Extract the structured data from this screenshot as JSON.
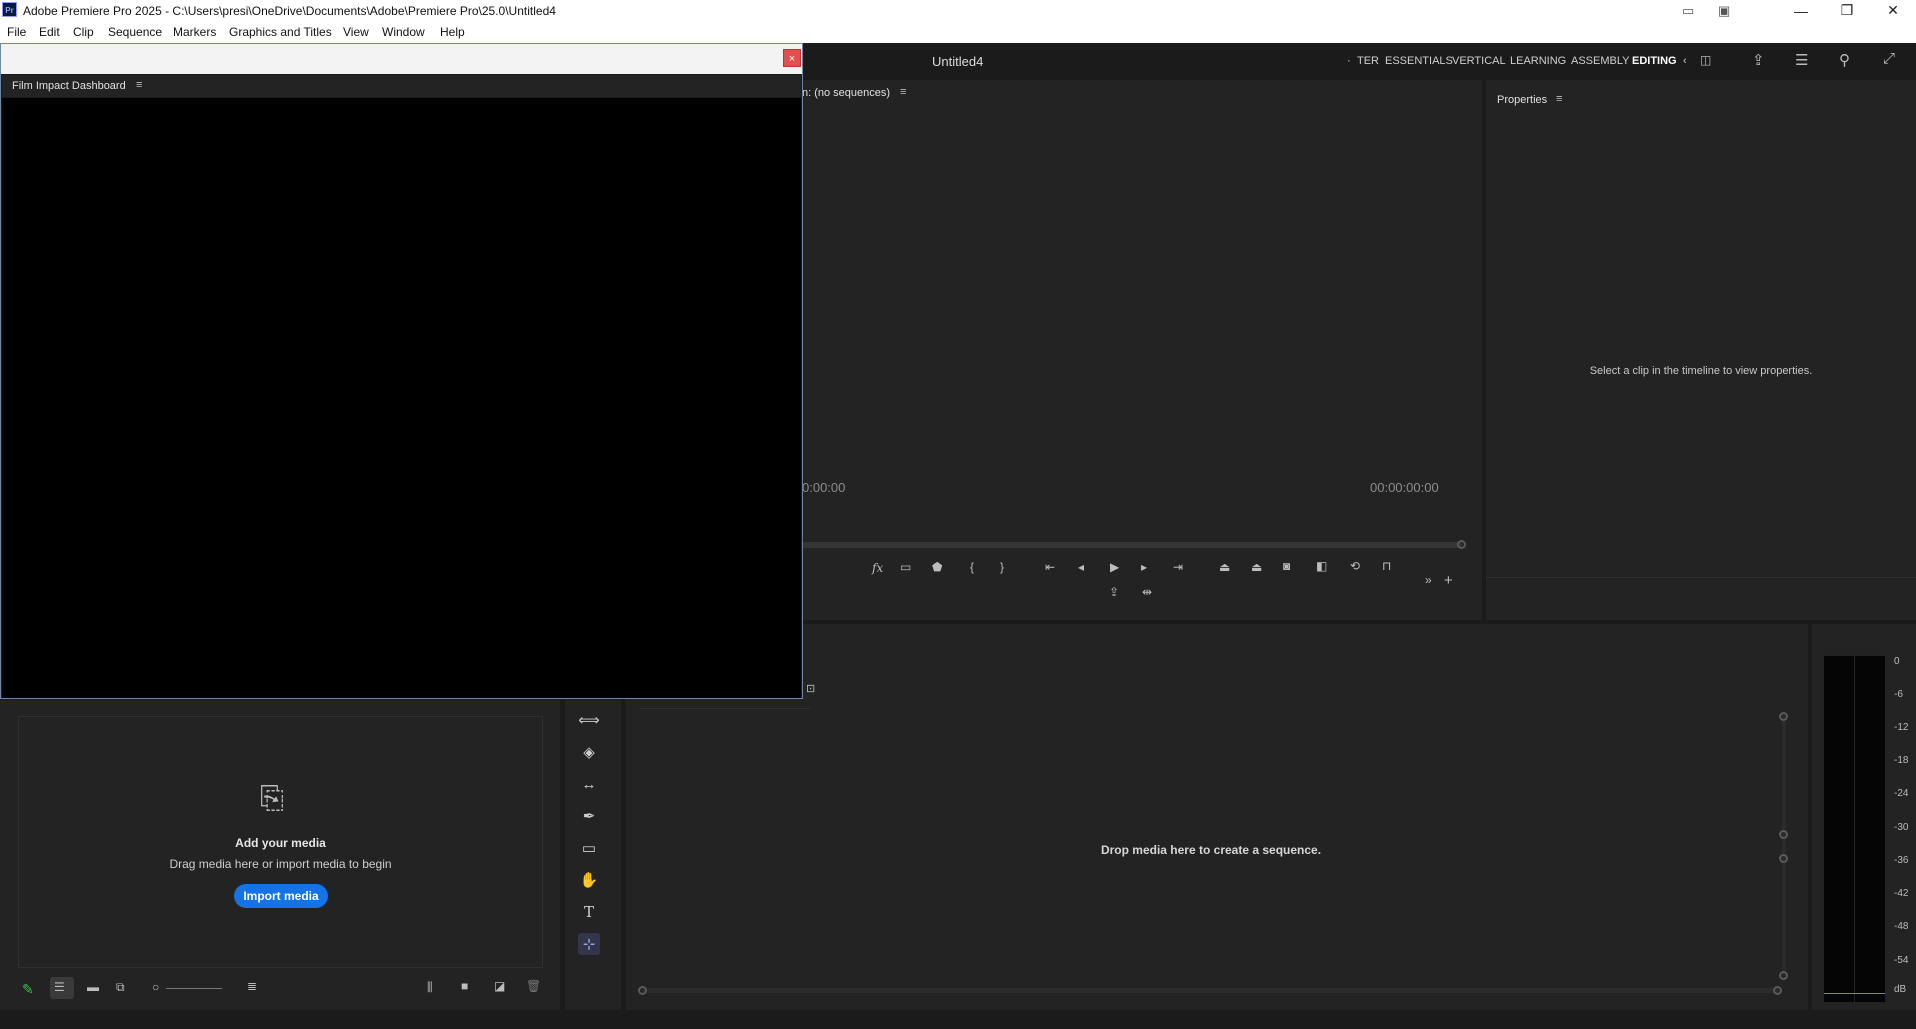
{
  "window": {
    "app_logo": "Pr",
    "title": "Adobe Premiere Pro 2025 - C:\\Users\\presi\\OneDrive\\Documents\\Adobe\\Premiere Pro\\25.0\\Untitled4"
  },
  "menu": [
    "File",
    "Edit",
    "Clip",
    "Sequence",
    "Markers",
    "Graphics and Titles",
    "View",
    "Window",
    "Help"
  ],
  "header": {
    "project_title": "Untitled4",
    "workspaces": [
      "TER",
      "ESSENTIALS",
      "VERTICAL",
      "LEARNING",
      "ASSEMBLY",
      "EDITING"
    ],
    "active_workspace": "EDITING",
    "overflow_left": "·",
    "overflow_right": "‹"
  },
  "floating_panel": {
    "title": "Film Impact Dashboard",
    "close_glyph": "×"
  },
  "program_monitor": {
    "tab_label": "n: (no sequences)",
    "timecode_left": "0:00:00",
    "timecode_right": "00:00:00:00"
  },
  "properties": {
    "tab_label": "Properties",
    "empty_message": "Select a clip in the timeline to view properties."
  },
  "project_panel": {
    "add_media_title": "Add your media",
    "add_media_hint": "Drag media here or import media to begin",
    "import_button": "Import media"
  },
  "timeline": {
    "drop_message": "Drop media here to create a sequence."
  },
  "audio_meter": {
    "scale": [
      "0",
      "-6",
      "-12",
      "-18",
      "-24",
      "-30",
      "-36",
      "-42",
      "-48",
      "-54",
      "dB"
    ]
  },
  "colors": {
    "accent": "#1473e6",
    "panel_bg": "#232323",
    "close_button": "#e05050"
  },
  "icons": [
    "hamburger-icon",
    "minimize-icon",
    "maximize-icon",
    "close-icon",
    "share-icon",
    "quick-actions-icon",
    "search-icon",
    "fullscreen-icon",
    "fx-icon",
    "play-icon",
    "step-back-icon",
    "step-forward-icon",
    "marker-icon",
    "camera-icon",
    "add-icon",
    "ripple-edit-tool-icon",
    "razor-tool-icon",
    "slip-tool-icon",
    "pen-tool-icon",
    "rectangle-tool-icon",
    "hand-tool-icon",
    "type-tool-icon",
    "text-edit-tool-icon",
    "import-media-icon"
  ]
}
